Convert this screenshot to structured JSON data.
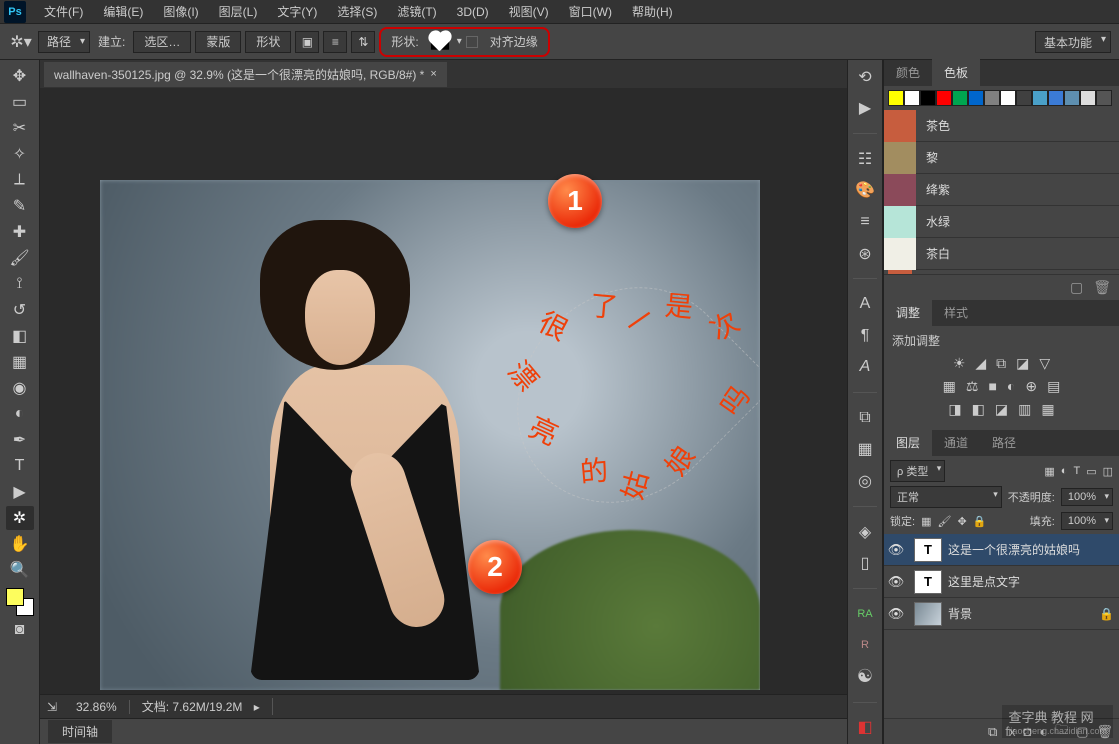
{
  "app": {
    "logo": "Ps"
  },
  "menu": [
    "文件(F)",
    "编辑(E)",
    "图像(I)",
    "图层(L)",
    "文字(Y)",
    "选择(S)",
    "滤镜(T)",
    "3D(D)",
    "视图(V)",
    "窗口(W)",
    "帮助(H)"
  ],
  "options": {
    "pathmode": "路径",
    "build_label": "建立:",
    "buttons": {
      "selection": "选区…",
      "mask": "蒙版",
      "shape": "形状"
    },
    "shape_label": "形状:",
    "align_label": "对齐边缘",
    "workspace": "基本功能"
  },
  "document": {
    "tab_title": "wallhaven-350125.jpg @ 32.9% (这是一个很漂亮的姑娘吗, RGB/8#) *",
    "zoom": "32.86%",
    "docsize_label": "文档:",
    "docsize": "7.62M/19.2M",
    "timeline": "时间轴"
  },
  "canvas_text": {
    "chars": [
      "很",
      "了",
      "一",
      "是",
      "次",
      "漂",
      "亮",
      "吗",
      "的",
      "姑",
      "娘"
    ],
    "badge1": "1",
    "badge2": "2"
  },
  "swatches": {
    "tab_color": "颜色",
    "tab_swatch": "色板",
    "grid": [
      "#ffff00",
      "#ffffff",
      "#000000",
      "#ff0000",
      "#00a550",
      "#0066cc",
      "#808080",
      "#ffffff",
      "#404040",
      "#4aa0c8",
      "#3b7bd6",
      "#5e8fb0",
      "#dddddd",
      "#555555"
    ],
    "list": [
      {
        "name": "茶色",
        "color": "#c75d3e"
      },
      {
        "name": "黎",
        "color": "#a28d60"
      },
      {
        "name": "绛紫",
        "color": "#8b4a5a"
      },
      {
        "name": "水绿",
        "color": "#b6e5d8"
      },
      {
        "name": "茶白",
        "color": "#f0efe6"
      }
    ]
  },
  "adjust": {
    "tab_adjust": "调整",
    "tab_style": "样式",
    "add_label": "添加调整"
  },
  "layers": {
    "tab_layers": "图层",
    "tab_channels": "通道",
    "tab_paths": "路径",
    "kind_label": "ρ 类型",
    "blend": "正常",
    "opacity_label": "不透明度:",
    "opacity": "100%",
    "lock_label": "锁定:",
    "fill_label": "填充:",
    "fill": "100%",
    "items": [
      {
        "name": "这是一个很漂亮的姑娘吗",
        "type": "T",
        "selected": true,
        "locked": false
      },
      {
        "name": "这里是点文字",
        "type": "T",
        "selected": false,
        "locked": false
      },
      {
        "name": "背景",
        "type": "img",
        "selected": false,
        "locked": true
      }
    ]
  },
  "watermark": {
    "main": "查字典 教程 网",
    "sub": "jiaocheng.chazidian.com"
  }
}
